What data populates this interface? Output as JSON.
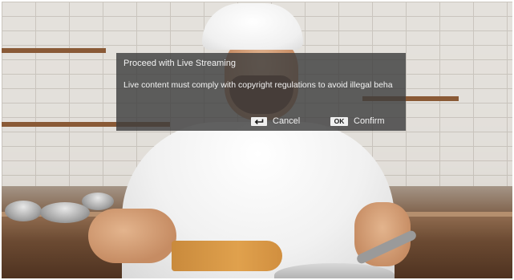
{
  "dialog": {
    "title": "Proceed with Live Streaming",
    "message": "Live content must comply with copyright regulations to avoid illegal beha",
    "cancel": {
      "key_icon": "return-arrow-icon",
      "label": "Cancel"
    },
    "confirm": {
      "key_icon": "ok-key-icon",
      "key_text": "OK",
      "label": "Confirm"
    }
  },
  "colors": {
    "dialog_bg": "#3e3e3e",
    "dialog_text": "#f2f2f2",
    "key_badge_bg": "#f0f0f0"
  }
}
